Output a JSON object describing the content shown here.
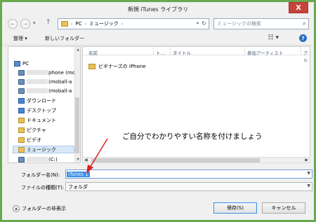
{
  "window": {
    "title": "新規 iTunes ライブラリ",
    "close_glyph": "X"
  },
  "nav": {
    "back_glyph": "←",
    "forward_glyph": "→",
    "recent_glyph": "▾",
    "up_glyph": "↑",
    "breadcrumb": [
      "PC",
      "ミュージック"
    ],
    "separator": "›",
    "search_placeholder": "ミュージックの検索",
    "refresh_glyph": "↻",
    "search_icon": "search-icon"
  },
  "toolbar": {
    "organize_label": "整理 ▾",
    "new_folder_label": "新しいフォルダー",
    "view_glyph": "☷ ▾",
    "help_glyph": "?"
  },
  "sidebar": {
    "items": [
      {
        "label": "PC",
        "icon": "pc-icon",
        "indent": 0
      },
      {
        "label": "phone (mo",
        "icon": "drive-icon",
        "indent": 1,
        "redacted": true
      },
      {
        "label": "(moball-a",
        "icon": "drive-icon",
        "indent": 1,
        "redacted": true
      },
      {
        "label": "(moball-a",
        "icon": "drive-icon",
        "indent": 1,
        "redacted": true
      },
      {
        "label": "ダウンロード",
        "icon": "download-folder-icon",
        "indent": 1
      },
      {
        "label": "デスクトップ",
        "icon": "desktop-folder-icon",
        "indent": 1
      },
      {
        "label": "ドキュメント",
        "icon": "documents-folder-icon",
        "indent": 1
      },
      {
        "label": "ピクチャ",
        "icon": "pictures-folder-icon",
        "indent": 1
      },
      {
        "label": "ビデオ",
        "icon": "videos-folder-icon",
        "indent": 1
      },
      {
        "label": "ミュージック",
        "icon": "music-folder-icon",
        "indent": 1,
        "selected": true
      },
      {
        "label": "(C:)",
        "icon": "drive-icon",
        "indent": 1,
        "redacted": true
      }
    ]
  },
  "file_list": {
    "columns": [
      "名前",
      "ト...",
      "タイトル",
      "参加アーティスト",
      "アル"
    ],
    "rows": [
      {
        "name": "ビギナーズの iPhone",
        "icon": "folder-icon"
      }
    ]
  },
  "annotation": {
    "text": "ご自分でわかりやすい名称を付けましょう",
    "color": "#e02020"
  },
  "form": {
    "name_label": "フォルダー名(N):",
    "name_value": "iTunes 1",
    "type_label": "ファイルの種類(T):",
    "type_value": "フォルダ"
  },
  "footer": {
    "hide_folders_label": "フォルダーの非表示",
    "save_label": "保存(S)",
    "cancel_label": "キャンセル"
  },
  "colors": {
    "frame": "#6aa84f",
    "accent": "#3a8ee6",
    "close": "#c7443b"
  }
}
